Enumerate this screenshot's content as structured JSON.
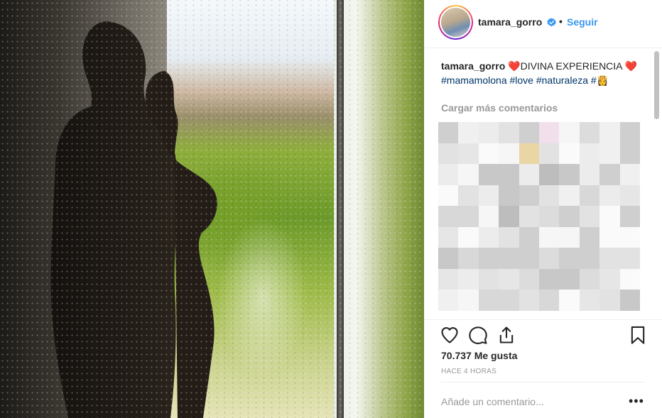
{
  "post": {
    "username": "tamara_gorro",
    "separator": "•",
    "follow_label": "Seguir",
    "caption_user": "tamara_gorro",
    "caption_text": "❤️DIVINA EXPERIENCIA ❤️",
    "hashtags": [
      "#mamamolona",
      "#love",
      "#naturaleza",
      "#👸"
    ],
    "load_more_label": "Cargar más comentarios",
    "likes": "70.737 Me gusta",
    "time": "HACE 4 HORAS",
    "comment_placeholder": "Añade un comentario...",
    "more_label": "•••"
  },
  "icons": {
    "verified": "verified-badge-icon",
    "like": "heart-icon",
    "comment": "comment-icon",
    "share": "share-icon",
    "save": "bookmark-icon"
  },
  "colors": {
    "link_blue": "#3897f0",
    "hashtag": "#003569",
    "muted": "#999999",
    "text": "#262626"
  }
}
